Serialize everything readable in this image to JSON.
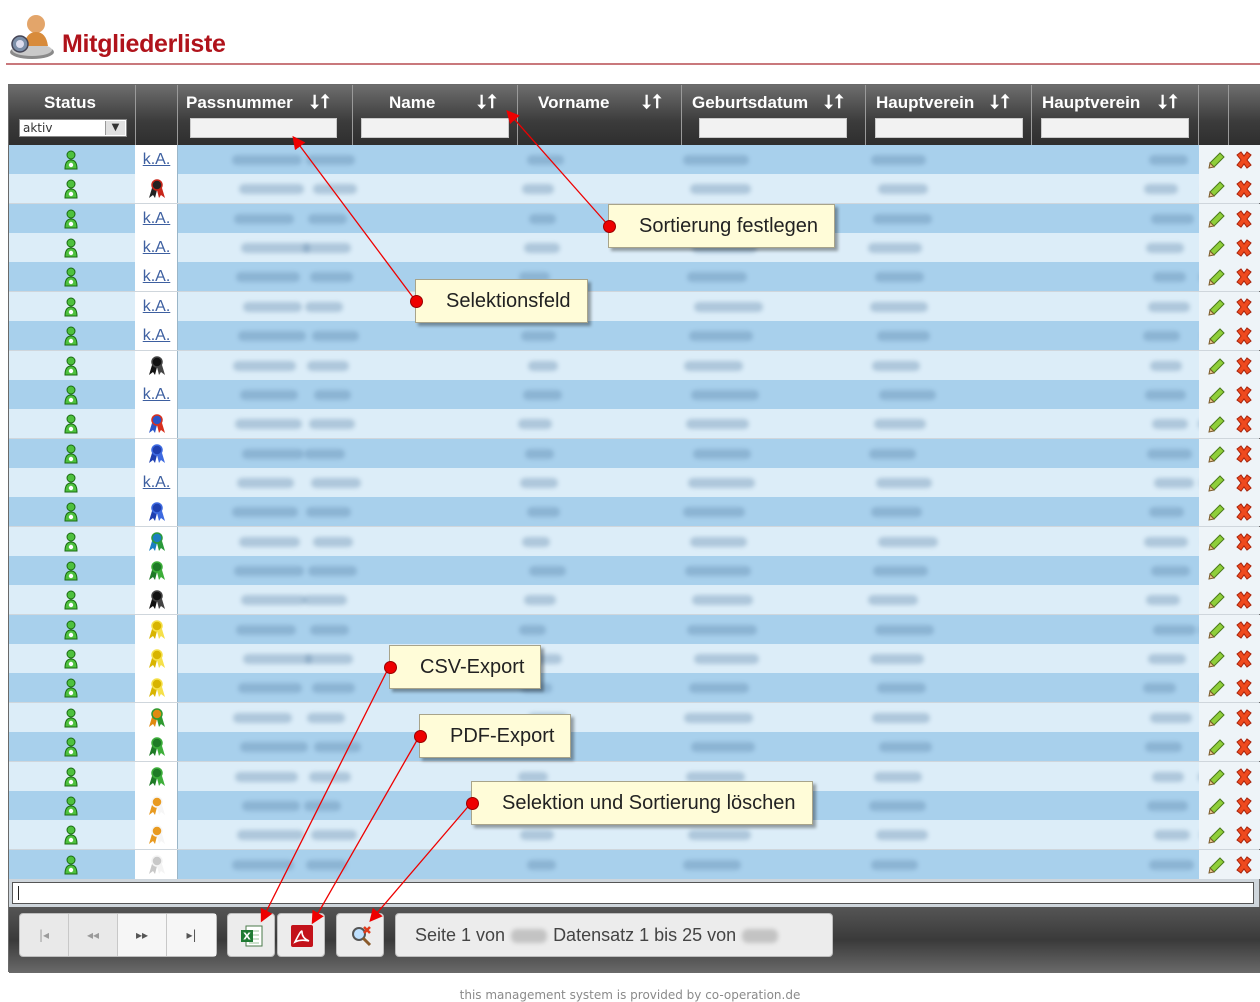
{
  "header": {
    "title": "Mitgliederliste",
    "icon": "members-icon"
  },
  "columns": {
    "status": {
      "label": "Status",
      "filter_value": "aktiv"
    },
    "passnummer": {
      "label": "Passnummer",
      "sort_arrows": "⭣⭡"
    },
    "name": {
      "label": "Name",
      "sort_arrows": "⭣⭡"
    },
    "vorname": {
      "label": "Vorname",
      "sort_arrows": "⭣⭡"
    },
    "geburtsdatum": {
      "label": "Geburtsdatum",
      "sort_arrows": "⭣⭡"
    },
    "hauptverein1": {
      "label": "Hauptverein",
      "sort_arrows": "⭣⭡"
    },
    "hauptverein2": {
      "label": "Hauptverein",
      "sort_arrows": "⭣⭡"
    }
  },
  "rows": [
    {
      "award": "k.A."
    },
    {
      "award": "ribbon-dark-red"
    },
    {
      "award": "k.A."
    },
    {
      "award": "k.A."
    },
    {
      "award": "k.A."
    },
    {
      "award": "k.A."
    },
    {
      "award": "k.A."
    },
    {
      "award": "ribbon-black"
    },
    {
      "award": "k.A."
    },
    {
      "award": "ribbon-red-blue"
    },
    {
      "award": "ribbon-blue"
    },
    {
      "award": "k.A."
    },
    {
      "award": "ribbon-blue"
    },
    {
      "award": "ribbon-blue-green"
    },
    {
      "award": "ribbon-green"
    },
    {
      "award": "ribbon-black"
    },
    {
      "award": "ribbon-yellow"
    },
    {
      "award": "ribbon-yellow"
    },
    {
      "award": "ribbon-yellow"
    },
    {
      "award": "ribbon-orange-green"
    },
    {
      "award": "ribbon-green"
    },
    {
      "award": "ribbon-green"
    },
    {
      "award": "ribbon-orange-white"
    },
    {
      "award": "ribbon-orange-white"
    },
    {
      "award": "ribbon-white"
    }
  ],
  "pagination": {
    "first": "|◂",
    "prev": "◂◂",
    "next": "▸▸",
    "last": "▸|",
    "page_label": "Seite 1 von",
    "record_label": "Datensatz 1 bis 25 von"
  },
  "callouts": {
    "sort": "Sortierung festlegen",
    "filter": "Selektionsfeld",
    "csv": "CSV-Export",
    "pdf": "PDF-Export",
    "reset": "Selektion und Sortierung löschen"
  },
  "footer": {
    "text": "this management system is provided by co-operation.de"
  },
  "colors": {
    "title": "#b0131b",
    "row_odd": "#a8d0ec",
    "row_even": "#dcedf8",
    "callout_bg": "#fffcd8",
    "marker": "#ee0000"
  }
}
